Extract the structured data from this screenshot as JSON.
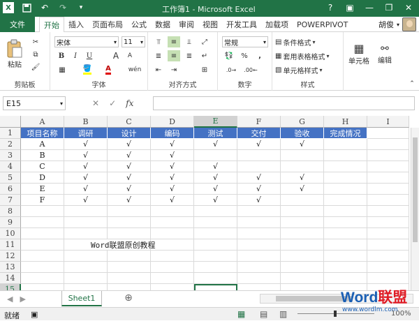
{
  "colors": {
    "brand": "#217346",
    "header_fill": "#4472c4",
    "selection": "#217346"
  },
  "titlebar": {
    "title": "工作簿1 - Microsoft Excel",
    "save_icon": "save-icon",
    "undo_icon": "undo-icon",
    "redo_icon": "redo-icon",
    "help": "?",
    "minimize": "—",
    "restore": "❐",
    "close": "✕"
  },
  "menu": {
    "file": "文件",
    "tabs": [
      "开始",
      "插入",
      "页面布局",
      "公式",
      "数据",
      "审阅",
      "视图",
      "开发工具",
      "加载项",
      "POWERPIVOT"
    ],
    "active_tab": "开始",
    "user": "胡俊"
  },
  "ribbon": {
    "clipboard": {
      "label": "剪贴板",
      "paste": "粘贴"
    },
    "font": {
      "label": "字体",
      "name": "宋体",
      "size": "11",
      "bold": "B",
      "italic": "I",
      "underline": "U",
      "inc": "A",
      "dec": "A",
      "phonetic": "wén"
    },
    "alignment": {
      "label": "对齐方式"
    },
    "number": {
      "label": "数字",
      "format": "常规",
      "percent": "%",
      "comma": ","
    },
    "styles": {
      "label": "样式",
      "conditional": "条件格式",
      "table": "套用表格格式",
      "cell_styles": "单元格样式"
    },
    "cells": {
      "label": "单元格"
    },
    "editing": {
      "label": "编辑"
    }
  },
  "formula_bar": {
    "name_box": "E15",
    "fx": "fx",
    "cancel": "✕",
    "enter": "✓",
    "value": ""
  },
  "columns": [
    "A",
    "B",
    "C",
    "D",
    "E",
    "F",
    "G",
    "H",
    "I"
  ],
  "rows": [
    "1",
    "2",
    "3",
    "4",
    "5",
    "6",
    "7",
    "8",
    "9",
    "10",
    "11",
    "12",
    "13",
    "14",
    "15"
  ],
  "table": {
    "headers": [
      "项目名称",
      "调研",
      "设计",
      "编码",
      "测试",
      "交付",
      "验收",
      "完成情况"
    ],
    "rows": [
      {
        "name": "A",
        "marks": [
          "√",
          "√",
          "√",
          "√",
          "√",
          "√",
          ""
        ]
      },
      {
        "name": "B",
        "marks": [
          "√",
          "√",
          "√",
          "",
          "",
          "",
          ""
        ]
      },
      {
        "name": "C",
        "marks": [
          "√",
          "√",
          "√",
          "√",
          "",
          "",
          ""
        ]
      },
      {
        "name": "D",
        "marks": [
          "√",
          "√",
          "√",
          "√",
          "√",
          "√",
          ""
        ]
      },
      {
        "name": "E",
        "marks": [
          "√",
          "√",
          "√",
          "√",
          "√",
          "√",
          ""
        ]
      },
      {
        "name": "F",
        "marks": [
          "√",
          "√",
          "√",
          "√",
          "√",
          "",
          ""
        ]
      }
    ]
  },
  "note": "Word联盟原创教程",
  "sheet": {
    "tab": "Sheet1",
    "add": "⊕"
  },
  "status": {
    "ready": "就绪",
    "zoom": "100%"
  },
  "watermark": {
    "brand1": "Word",
    "brand2": "联盟",
    "site": "www.wordlm.com"
  }
}
